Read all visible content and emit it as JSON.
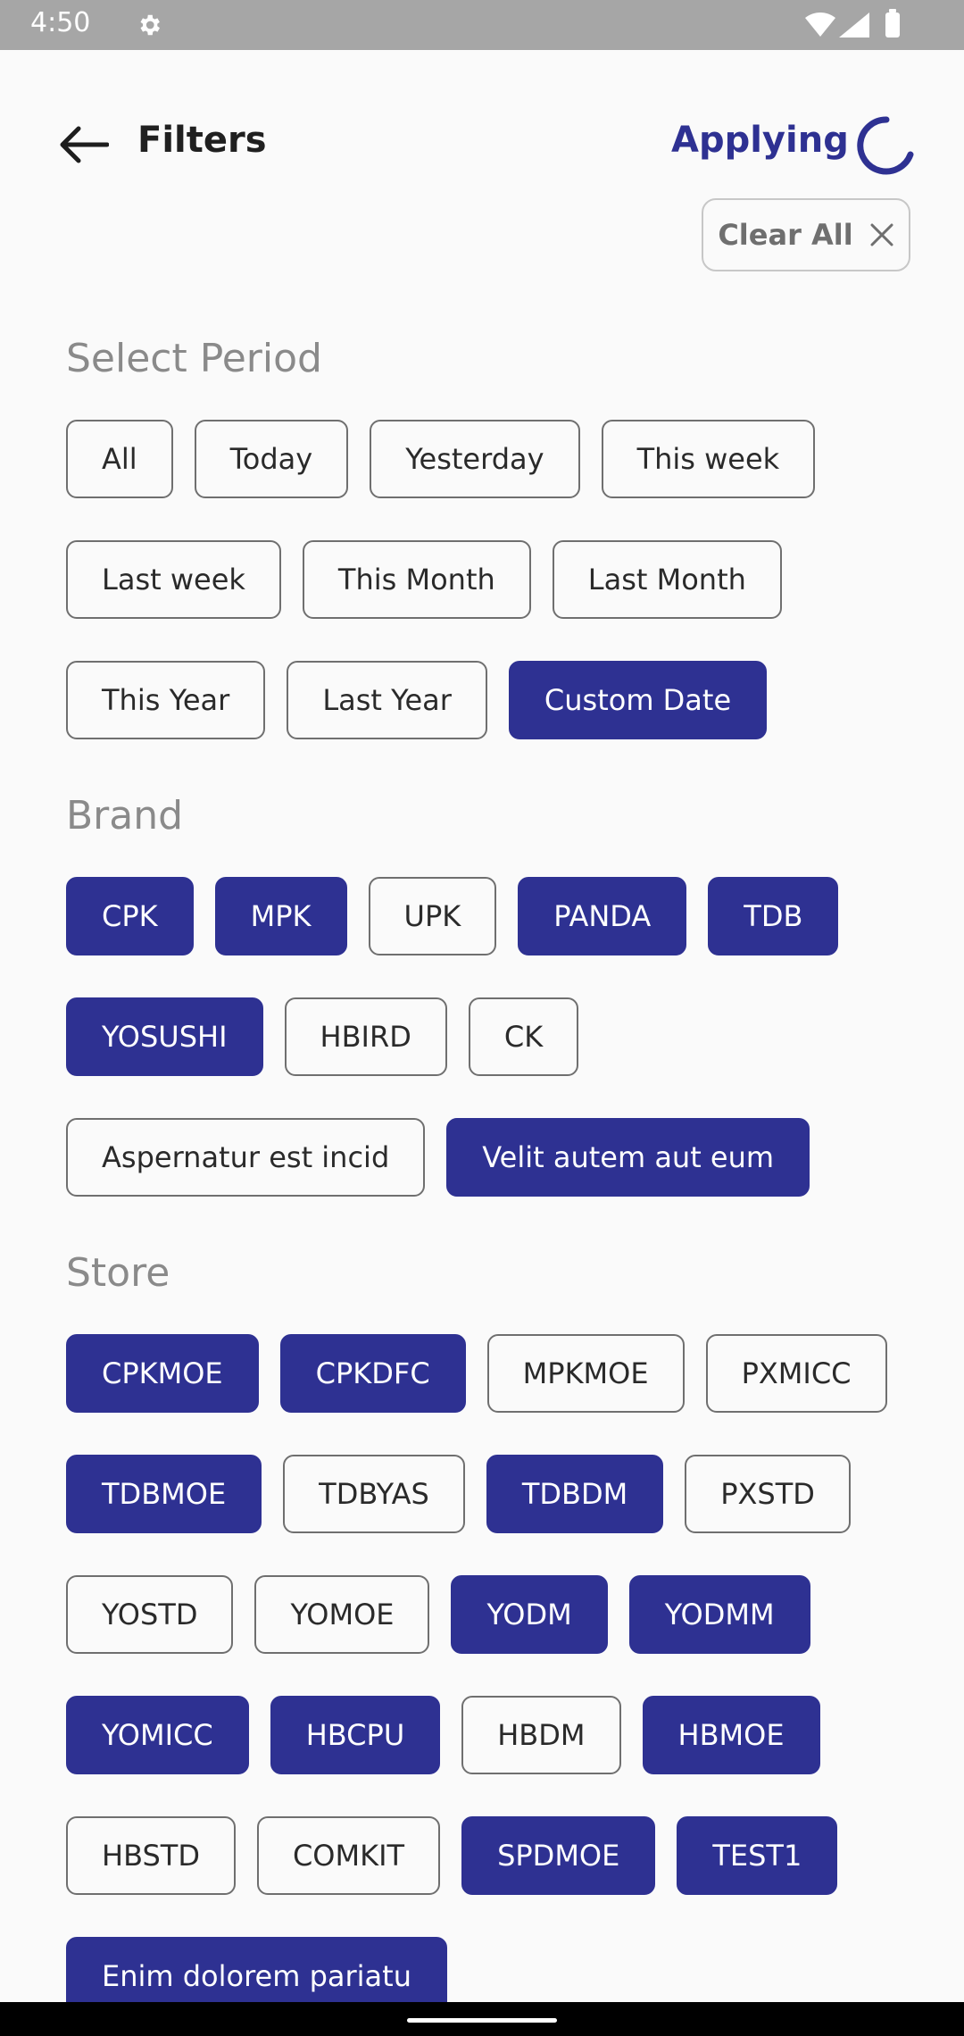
{
  "status_bar": {
    "time": "4:50",
    "icons": [
      "gear-icon",
      "wifi-icon",
      "signal-icon",
      "battery-icon"
    ]
  },
  "header": {
    "title": "Filters",
    "action_label": "Applying",
    "back_icon": "arrow-left-icon",
    "loading_icon": "spinner-icon"
  },
  "clear_all": {
    "label": "Clear All",
    "icon": "close-icon"
  },
  "colors": {
    "accent": "#2e3192",
    "section_title": "#8a8a8a",
    "chip_border": "#6f6f6f"
  },
  "period": {
    "title": "Select Period",
    "options": [
      {
        "label": "All",
        "selected": false
      },
      {
        "label": "Today",
        "selected": false
      },
      {
        "label": "Yesterday",
        "selected": false
      },
      {
        "label": "This week",
        "selected": false
      },
      {
        "label": "Last week",
        "selected": false
      },
      {
        "label": "This Month",
        "selected": false
      },
      {
        "label": "Last Month",
        "selected": false
      },
      {
        "label": "This Year",
        "selected": false
      },
      {
        "label": "Last Year",
        "selected": false
      },
      {
        "label": "Custom Date",
        "selected": true
      }
    ]
  },
  "brand": {
    "title": "Brand",
    "options": [
      {
        "label": "CPK",
        "selected": true
      },
      {
        "label": "MPK",
        "selected": true
      },
      {
        "label": "UPK",
        "selected": false
      },
      {
        "label": "PANDA",
        "selected": true
      },
      {
        "label": "TDB",
        "selected": true
      },
      {
        "label": "YOSUSHI",
        "selected": true
      },
      {
        "label": "HBIRD",
        "selected": false
      },
      {
        "label": "CK",
        "selected": false
      },
      {
        "label": "Aspernatur est incid",
        "selected": false
      },
      {
        "label": "Velit autem aut eum",
        "selected": true
      }
    ]
  },
  "store": {
    "title": "Store",
    "options": [
      {
        "label": "CPKMOE",
        "selected": true
      },
      {
        "label": "CPKDFC",
        "selected": true
      },
      {
        "label": "MPKMOE",
        "selected": false
      },
      {
        "label": "PXMICC",
        "selected": false
      },
      {
        "label": "TDBMOE",
        "selected": true
      },
      {
        "label": "TDBYAS",
        "selected": false
      },
      {
        "label": "TDBDM",
        "selected": true
      },
      {
        "label": "PXSTD",
        "selected": false
      },
      {
        "label": "YOSTD",
        "selected": false
      },
      {
        "label": "YOMOE",
        "selected": false
      },
      {
        "label": "YODM",
        "selected": true
      },
      {
        "label": "YODMM",
        "selected": true
      },
      {
        "label": "YOMICC",
        "selected": true
      },
      {
        "label": "HBCPU",
        "selected": true
      },
      {
        "label": "HBDM",
        "selected": false
      },
      {
        "label": "HBMOE",
        "selected": true
      },
      {
        "label": "HBSTD",
        "selected": false
      },
      {
        "label": "COMKIT",
        "selected": false
      },
      {
        "label": "SPDMOE",
        "selected": true
      },
      {
        "label": "TEST1",
        "selected": true
      },
      {
        "label": "Enim dolorem pariatu",
        "selected": true
      }
    ]
  }
}
